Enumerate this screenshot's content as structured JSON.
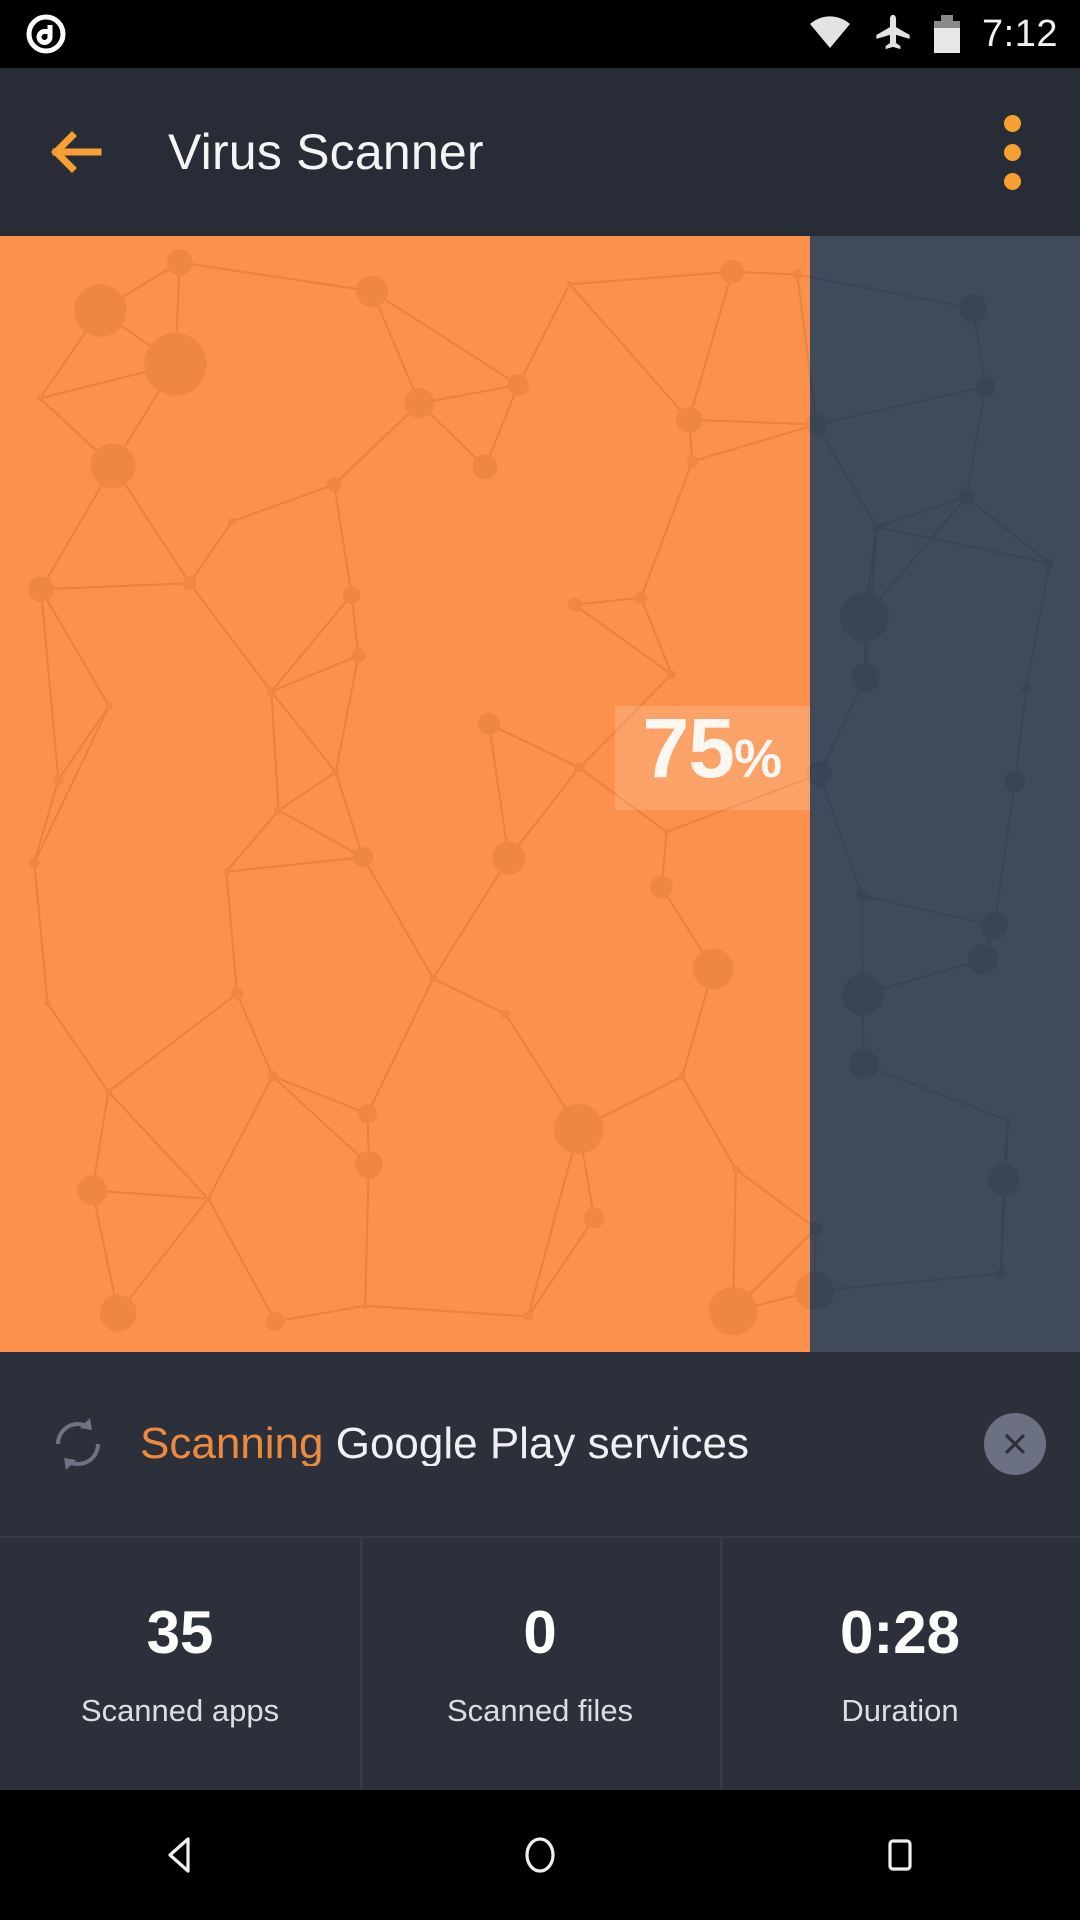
{
  "status_bar": {
    "notification_icon": "avast-logo-icon",
    "wifi_icon": "wifi-icon",
    "airplane_icon": "airplane-mode-icon",
    "battery_icon": "battery-icon",
    "clock": "7:12"
  },
  "header": {
    "back_icon": "back-arrow-icon",
    "title": "Virus Scanner",
    "overflow_icon": "overflow-menu-icon",
    "accent_color": "#f5a030",
    "background_color": "#272c36"
  },
  "scan": {
    "progress_percent": 75,
    "progress_label_number": "75",
    "progress_label_sign": "%",
    "fill_color": "#fb914c",
    "track_color": "#414a5a"
  },
  "status_row": {
    "sync_icon": "sync-refresh-icon",
    "action": "Scanning",
    "target": "Google Play services",
    "action_color": "#ef8a3c",
    "close_icon": "close-icon"
  },
  "stats": [
    {
      "value": "35",
      "label": "Scanned apps"
    },
    {
      "value": "0",
      "label": "Scanned files"
    },
    {
      "value": "0:28",
      "label": "Duration"
    }
  ],
  "nav_bar": {
    "back_icon": "nav-back-icon",
    "home_icon": "nav-home-icon",
    "recents_icon": "nav-recents-icon"
  }
}
